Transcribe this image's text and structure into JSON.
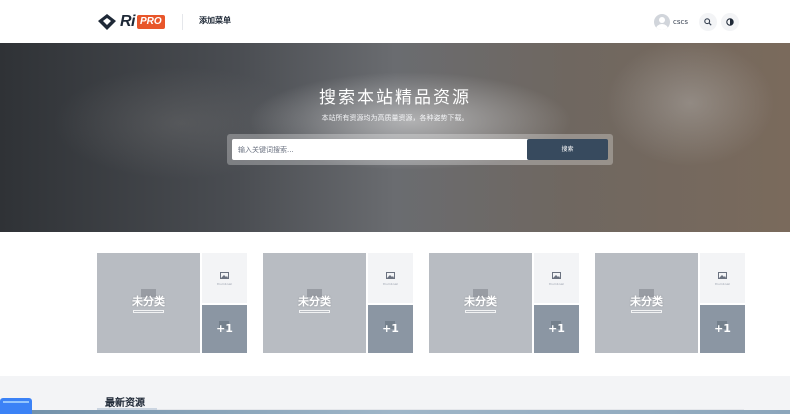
{
  "header": {
    "logo": {
      "text": "Ri",
      "badge": "PRO"
    },
    "nav": [
      {
        "label": "添加菜单"
      }
    ],
    "user": {
      "name": "cscs"
    },
    "icons": {
      "search": "search-icon",
      "theme": "theme-toggle-icon"
    }
  },
  "hero": {
    "title": "搜索本站精品资源",
    "subtitle": "本站所有资源均为高质量资源，各种姿势下载。",
    "search": {
      "placeholder": "输入关键词搜索...",
      "button_label": "搜索"
    }
  },
  "categories": [
    {
      "name": "未分类",
      "thumb_caption": "thumbnail",
      "more": "+1"
    },
    {
      "name": "未分类",
      "thumb_caption": "thumbnail",
      "more": "+1"
    },
    {
      "name": "未分类",
      "thumb_caption": "thumbnail",
      "more": "+1"
    },
    {
      "name": "未分类",
      "thumb_caption": "thumbnail",
      "more": "+1"
    }
  ],
  "latest": {
    "title": "最新资源"
  },
  "colors": {
    "accent": "#374a5e",
    "logo_badge": "#e8562a",
    "card_main": "#b8bcc2",
    "card_more": "#8b96a3"
  }
}
